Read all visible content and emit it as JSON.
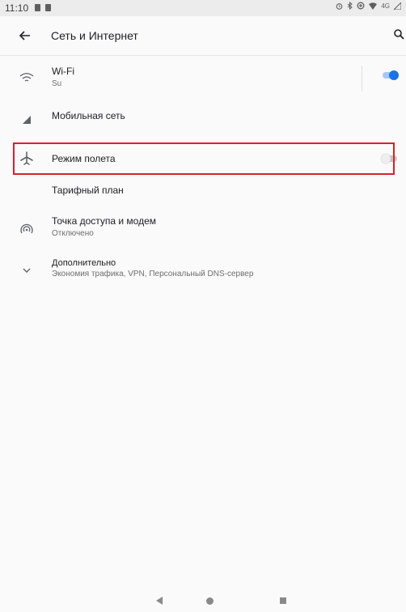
{
  "status_bar": {
    "time": "11:10",
    "network": "4G"
  },
  "app_bar": {
    "title": "Сеть и Интернет"
  },
  "rows": {
    "wifi": {
      "title": "Wi-Fi",
      "subtitle": "Su",
      "toggle_on": true
    },
    "mobile": {
      "title": "Мобильная сеть"
    },
    "airplane": {
      "title": "Режим полета",
      "toggle_on": false
    },
    "plan": {
      "title": "Тарифный план"
    },
    "hotspot": {
      "title": "Точка доступа и модем",
      "subtitle": "Отключено"
    },
    "advanced": {
      "title": "Дополнительно",
      "subtitle": "Экономия трафика, VPN, Персональный DNS-сервер"
    }
  },
  "colors": {
    "accent": "#1a73e8",
    "highlight": "#d7212b",
    "icon": "#5f6368"
  }
}
